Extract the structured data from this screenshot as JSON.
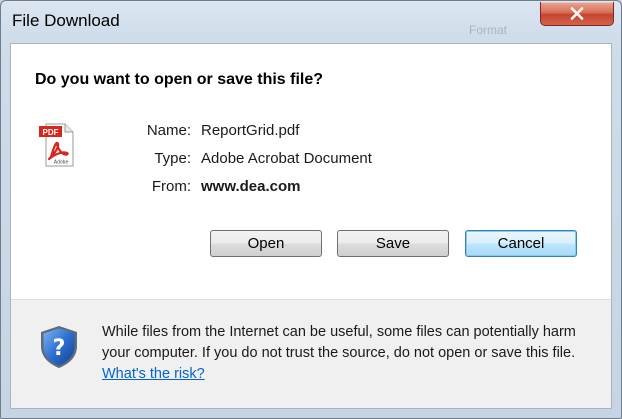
{
  "window": {
    "title": "File Download",
    "background_text": "Format"
  },
  "dialog": {
    "question": "Do you want to open or save this file?",
    "file_icon": "pdf-file-icon",
    "fields": {
      "name_label": "Name:",
      "name_value": "ReportGrid.pdf",
      "type_label": "Type:",
      "type_value": "Adobe Acrobat Document",
      "from_label": "From:",
      "from_value": "www.dea.com"
    },
    "buttons": {
      "open": "Open",
      "save": "Save",
      "cancel": "Cancel"
    }
  },
  "footer": {
    "icon": "security-shield-icon",
    "warning_text": "While files from the Internet can be useful, some files can potentially harm your computer. If you do not trust the source, do not open or save this file.",
    "risk_link": "What's the risk?"
  },
  "colors": {
    "link": "#0066cc",
    "close_button": "#c4452e",
    "default_button_border": "#3c7fb1"
  }
}
